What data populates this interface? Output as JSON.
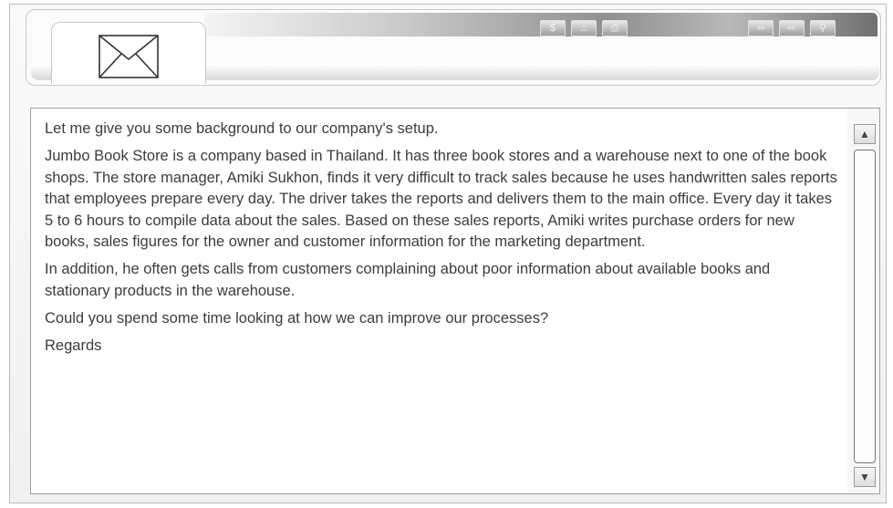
{
  "window": {
    "tab_icon": "envelope-icon"
  },
  "toolbar": {
    "buttons": [
      {
        "name": "dollar-icon",
        "glyph": "$"
      },
      {
        "name": "home-icon",
        "glyph": "⌂"
      },
      {
        "name": "print-icon",
        "glyph": "⎙"
      },
      {
        "name": "back-arrow-icon",
        "glyph": "⇦"
      },
      {
        "name": "forward-arrow-icon",
        "glyph": "⇨"
      },
      {
        "name": "person-icon",
        "glyph": "⚲"
      }
    ]
  },
  "email": {
    "paragraphs": [
      "Let me give you some background to our company's setup.",
      "Jumbo Book Store is a company based in Thailand. It has three book stores and a warehouse next to one of the book shops. The store manager, Amiki Sukhon, finds it very difficult to track sales because he uses handwritten sales reports that employees prepare every day. The driver takes the reports and delivers them to the main office. Every day it takes 5 to 6 hours to compile data about the sales. Based on these sales reports, Amiki writes purchase orders for new books, sales figures for the owner and customer information for the marketing department.",
      "In addition, he often gets calls from customers complaining about poor information about available books and stationary products in the warehouse.",
      "Could you spend some time looking at how we can improve our processes?",
      "Regards"
    ]
  },
  "scrollbar": {
    "up_glyph": "▲",
    "down_glyph": "▼"
  }
}
